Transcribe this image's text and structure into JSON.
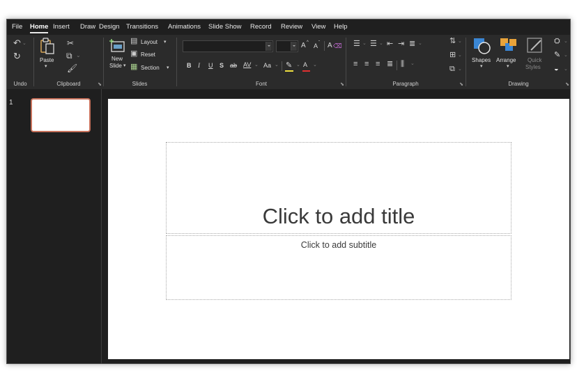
{
  "menu": {
    "tabs": [
      "File",
      "Home",
      "Insert",
      "Draw",
      "Design",
      "Transitions",
      "Animations",
      "Slide Show",
      "Record",
      "Review",
      "View",
      "Help"
    ],
    "active": "Home"
  },
  "ribbon": {
    "undo": {
      "label": "Undo"
    },
    "clipboard": {
      "label": "Clipboard",
      "paste": "Paste"
    },
    "slides": {
      "label": "Slides",
      "new_slide_line1": "New",
      "new_slide_line2": "Slide",
      "layout": "Layout",
      "reset": "Reset",
      "section": "Section"
    },
    "font": {
      "label": "Font",
      "font_name": "",
      "font_size": "",
      "bold": "B",
      "italic": "I",
      "underline": "U",
      "shadow": "S",
      "strike": "ab",
      "spacing": "AV",
      "case": "Aa",
      "grow": "A",
      "shrink": "A",
      "clear": "A",
      "highlight": "A",
      "color": "A"
    },
    "paragraph": {
      "label": "Paragraph"
    },
    "drawing": {
      "label": "Drawing",
      "shapes": "Shapes",
      "arrange": "Arrange",
      "quick_styles_1": "Quick",
      "quick_styles_2": "Styles"
    }
  },
  "thumbnails": {
    "slide_number": "1"
  },
  "slide": {
    "title_placeholder": "Click to add title",
    "subtitle_placeholder": "Click to add subtitle"
  },
  "colors": {
    "accent": "#c7725c",
    "ribbon_bg": "#2b2b2b",
    "window_bg": "#1f1f1f",
    "canvas_bg": "#ffffff"
  }
}
